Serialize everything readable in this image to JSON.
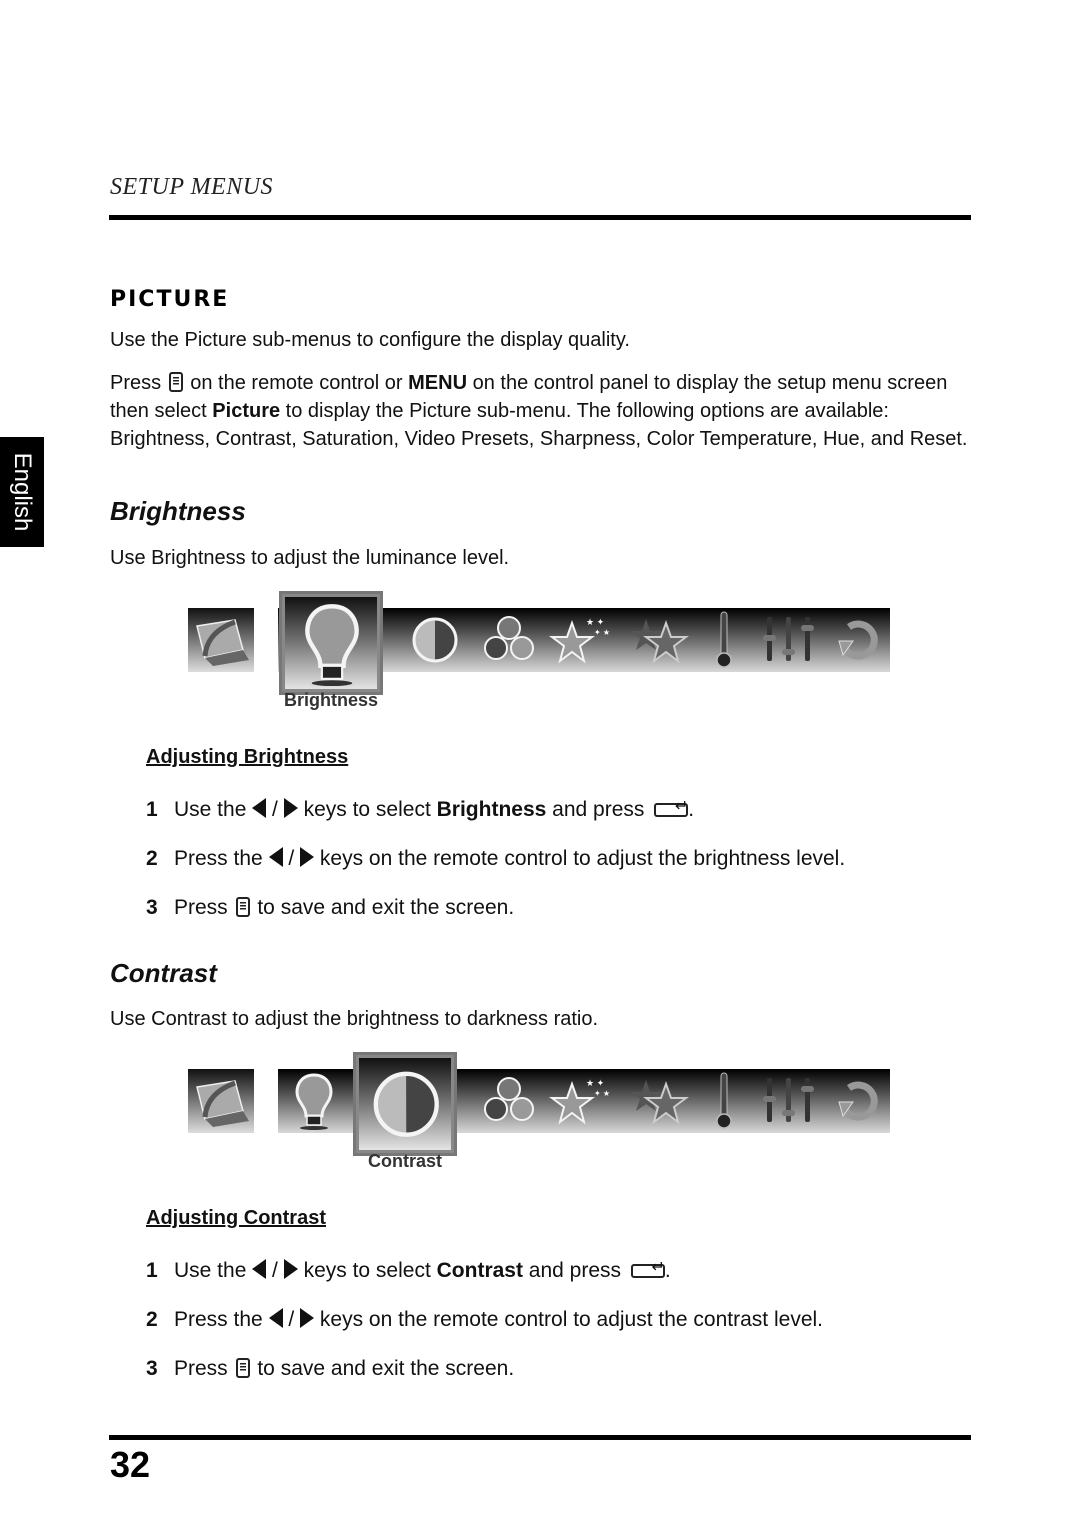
{
  "header": {
    "section": "SETUP MENUS"
  },
  "side_tab": {
    "language": "English"
  },
  "picture": {
    "title": "PICTURE",
    "intro": "Use the Picture sub-menus to configure the display quality.",
    "press_word": "Press",
    "press_icon": "menu-icon",
    "para_part1": " on the remote control or ",
    "menu_key": "MENU",
    "para_part2": " on the control panel to display the setup menu screen then select ",
    "picture_word": "Picture",
    "para_part3": " to display the Picture sub-menu. The following options are available: Brightness, Contrast, Saturation, Video Presets, Sharpness, Color Temperature, Hue, and Reset."
  },
  "menu_icons": [
    "laptop-icon",
    "lightbulb-icon",
    "contrast-circle-icon",
    "color-circles-icon",
    "sparkle-star-icon",
    "double-star-icon",
    "thermometer-icon",
    "sliders-icon",
    "reset-icon"
  ],
  "brightness": {
    "title": "Brightness",
    "description": "Use Brightness to adjust the luminance level.",
    "selected_label": "Brightness",
    "adjust_title": "Adjusting Brightness",
    "steps": [
      {
        "num": "1",
        "a": "Use the ",
        "sep": " / ",
        "b": " keys to select ",
        "bold": "Brightness",
        "c": " and press ",
        "end": "."
      },
      {
        "num": "2",
        "a": "Press the ",
        "sep": " / ",
        "b": " keys on the remote control to adjust the brightness level."
      },
      {
        "num": "3",
        "a": "Press ",
        "b": " to save and exit the screen."
      }
    ]
  },
  "contrast": {
    "title": "Contrast",
    "description": "Use Contrast to adjust the brightness to darkness ratio.",
    "selected_label": "Contrast",
    "adjust_title": "Adjusting Contrast",
    "steps": [
      {
        "num": "1",
        "a": "Use the ",
        "sep": " / ",
        "b": " keys to select ",
        "bold": "Contrast",
        "c": " and press ",
        "end": "."
      },
      {
        "num": "2",
        "a": "Press the ",
        "sep": " / ",
        "b": " keys on the remote control to adjust the contrast level."
      },
      {
        "num": "3",
        "a": "Press ",
        "b": " to save and exit the screen."
      }
    ]
  },
  "footer": {
    "page_number": "32"
  }
}
